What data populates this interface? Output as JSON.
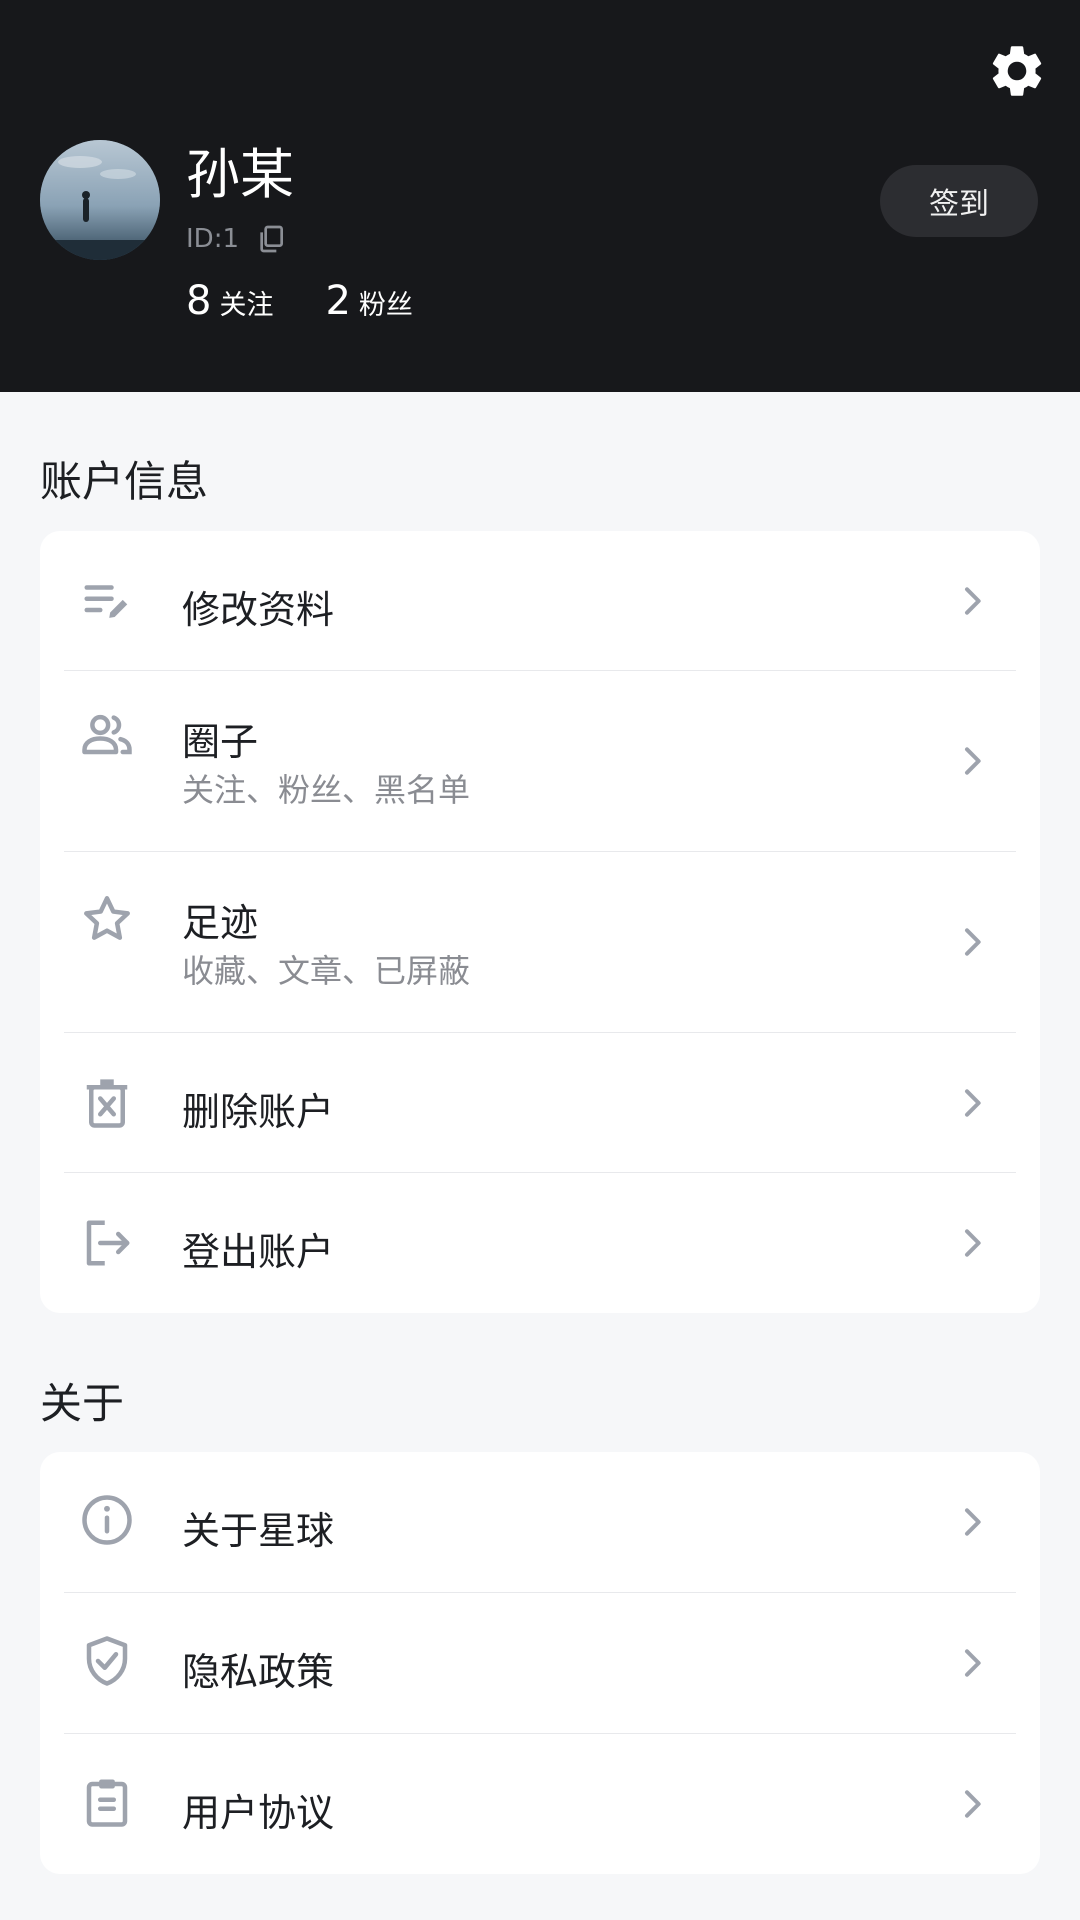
{
  "profile": {
    "name": "孙某",
    "id_text": "ID:1",
    "following_count": "8",
    "following_label": "关注",
    "followers_count": "2",
    "followers_label": "粉丝",
    "signin_label": "签到"
  },
  "account_section": {
    "title": "账户信息",
    "items": [
      {
        "title": "修改资料",
        "icon": "edit-list-icon"
      },
      {
        "title": "圈子",
        "subtitle": "关注、粉丝、黑名单",
        "icon": "group-icon"
      },
      {
        "title": "足迹",
        "subtitle": "收藏、文章、已屏蔽",
        "icon": "star-icon"
      },
      {
        "title": "删除账户",
        "icon": "trash-icon"
      },
      {
        "title": "登出账户",
        "icon": "logout-icon"
      }
    ]
  },
  "about_section": {
    "title": "关于",
    "items": [
      {
        "title": "关于星球",
        "icon": "info-icon"
      },
      {
        "title": "隐私政策",
        "icon": "shield-check-icon"
      },
      {
        "title": "用户协议",
        "icon": "clipboard-icon"
      }
    ]
  },
  "colors": {
    "header_bg": "#17181b",
    "page_bg": "#f6f7f9",
    "icon_gray": "#9ea3ad"
  }
}
